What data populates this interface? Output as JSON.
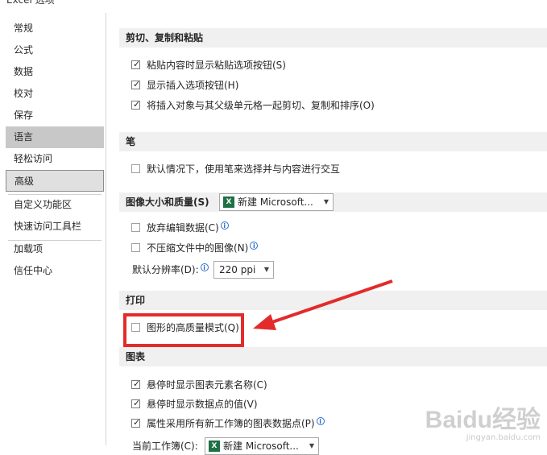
{
  "window": {
    "title": "Excel 选项"
  },
  "nav": {
    "items": [
      {
        "label": "常规"
      },
      {
        "label": "公式"
      },
      {
        "label": "数据"
      },
      {
        "label": "校对"
      },
      {
        "label": "保存"
      },
      {
        "label": "语言"
      },
      {
        "label": "轻松访问"
      },
      {
        "label": "高级"
      },
      {
        "label": "自定义功能区"
      },
      {
        "label": "快速访问工具栏"
      },
      {
        "label": "加载项"
      },
      {
        "label": "信任中心"
      }
    ]
  },
  "sections": {
    "cut_copy_paste": {
      "title": "剪切、复制和粘贴",
      "options": [
        {
          "label": "粘贴内容时显示粘贴选项按钮(S)",
          "checked": true
        },
        {
          "label": "显示插入选项按钮(H)",
          "checked": true
        },
        {
          "label": "将插入对象与其父级单元格一起剪切、复制和排序(O)",
          "checked": true
        }
      ]
    },
    "pen": {
      "title": "笔",
      "options": [
        {
          "label": "默认情况下，使用笔来选择并与内容进行交互",
          "checked": false
        }
      ]
    },
    "image_size_quality": {
      "title": "图像大小和质量(S)",
      "workbook": "新建 Microsoft...",
      "options": [
        {
          "label": "放弃编辑数据(C)",
          "checked": false
        },
        {
          "label": "不压缩文件中的图像(N)",
          "checked": false
        }
      ],
      "resolution_label": "默认分辨率(D):",
      "resolution_value": "220 ppi"
    },
    "print": {
      "title": "打印",
      "options": [
        {
          "label": "图形的高质量模式(Q)",
          "checked": false
        }
      ]
    },
    "chart": {
      "title": "图表",
      "options": [
        {
          "label": "悬停时显示图表元素名称(C)",
          "checked": true
        },
        {
          "label": "悬停时显示数据点的值(V)",
          "checked": true
        },
        {
          "label": "属性采用所有新工作簿的图表数据点(P)",
          "checked": true
        }
      ],
      "current_workbook_label": "当前工作簿(C):",
      "current_workbook_value": "新建 Microsoft..."
    }
  },
  "icons": {
    "info": "info-icon",
    "excel": "excel-file-icon",
    "dropdown": "chevron-down-icon"
  },
  "annotation": {
    "highlight_color": "#e32b2b"
  },
  "watermark": {
    "logo": "Baidu经验",
    "url": "jingyan.baidu.com"
  }
}
